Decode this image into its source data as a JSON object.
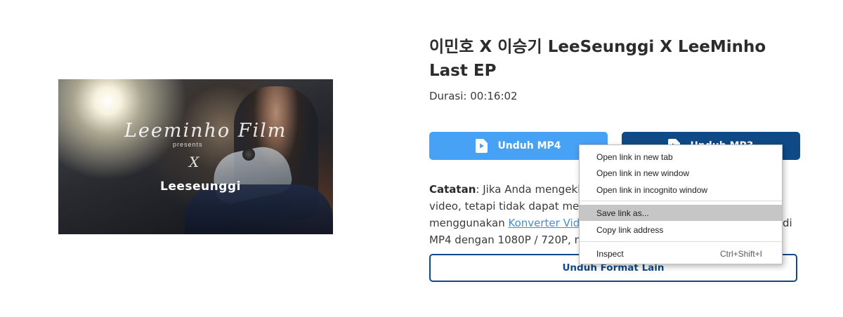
{
  "video": {
    "thumbnail": {
      "script_text": "Leeminho Film",
      "presents_text": "presents",
      "x_text": "X",
      "brand_text": "Leeseunggi"
    },
    "title": "이민호 X 이승기 LeeSeunggi X LeeMinho Last EP",
    "duration": "Durasi: 00:16:02"
  },
  "buttons": {
    "mp4_label": "Unduh MP4",
    "mp3_label": "Unduh MP3",
    "other_label": "Unduh Format Lain"
  },
  "note": {
    "label": "Catatan",
    "line1": ": Jika Anda mengekli",
    "line1_tail": "",
    "line2": "video, tetapi tidak dapat men",
    "line3_prefix": "menggunakan ",
    "line3_link": "Konverter Vid",
    "line3_tail": "di",
    "line4": "MP4 dengan 1080P / 720P, n"
  },
  "context_menu": {
    "items": [
      {
        "label": "Open link in new tab",
        "shortcut": ""
      },
      {
        "label": "Open link in new window",
        "shortcut": ""
      },
      {
        "label": "Open link in incognito window",
        "shortcut": ""
      },
      {
        "label": "Save link as...",
        "shortcut": ""
      },
      {
        "label": "Copy link address",
        "shortcut": ""
      },
      {
        "label": "Inspect",
        "shortcut": "Ctrl+Shift+I"
      }
    ],
    "highlighted_index": 3
  },
  "colors": {
    "mp4_button": "#47a1f5",
    "mp3_button": "#0f4a86",
    "link": "#3d8fe0",
    "menu_highlight": "#c6c6c6"
  }
}
